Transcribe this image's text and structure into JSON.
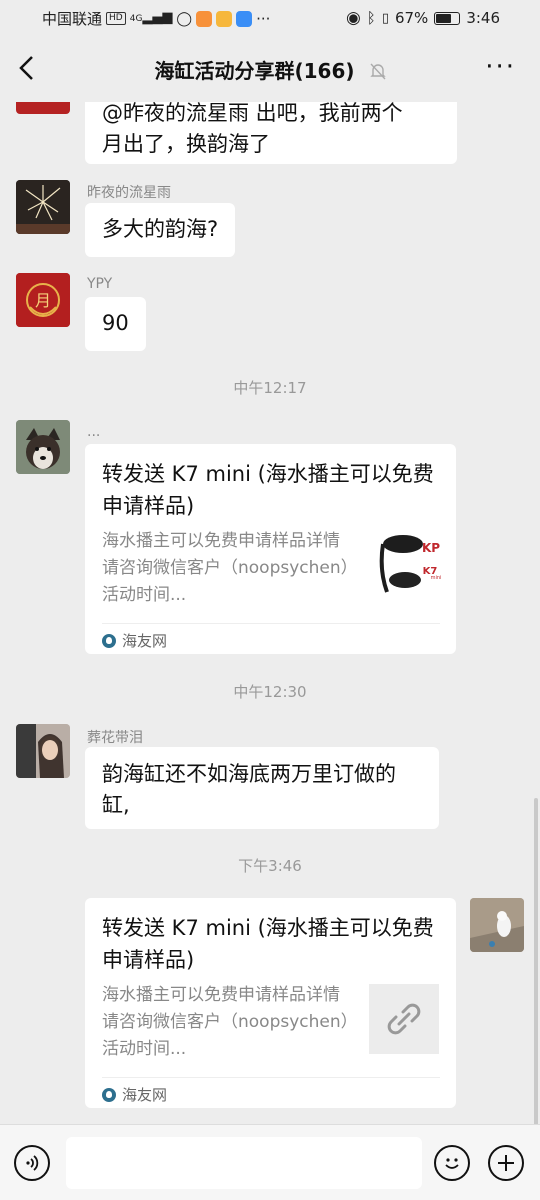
{
  "status_bar": {
    "carrier": "中国联通",
    "hd": "HD",
    "network": "4G",
    "more": "···",
    "battery": "67%",
    "battery_level": 0.67,
    "time": "3:46"
  },
  "nav": {
    "title": "海缸活动分享群(166)",
    "back_icon": "back-chevron-icon",
    "mute_icon": "bell-muted-icon",
    "more_icon": "more-icon"
  },
  "messages": [
    {
      "type": "text",
      "sender": "",
      "text_line1": "@昨夜的流星雨  出吧，我前两个",
      "text_line2": "月出了，换韵海了"
    },
    {
      "type": "text",
      "sender": "昨夜的流星雨",
      "text": "多大的韵海?"
    },
    {
      "type": "text",
      "sender": "YPY",
      "text": "90"
    },
    {
      "type": "time",
      "text": "中午12:17"
    },
    {
      "type": "card",
      "sender": "...",
      "title": "转发送 K7 mini (海水播主可以免费申请样品)",
      "desc": "海水播主可以免费申请样品详情请咨询微信客户（noopsychen）活动时间...",
      "source": "海友网"
    },
    {
      "type": "time",
      "text": "中午12:30"
    },
    {
      "type": "text",
      "sender": "葬花带泪",
      "text": "韵海缸还不如海底两万里订做的缸,"
    },
    {
      "type": "time",
      "text": "下午3:46"
    },
    {
      "type": "card-self",
      "title": "转发送 K7 mini (海水播主可以免费申请样品)",
      "desc": "海水播主可以免费申请样品详情请咨询微信客户（noopsychen）活动时间...",
      "source": "海友网",
      "thumb_icon": "link-icon"
    }
  ],
  "thumb_labels": {
    "brand": "KP",
    "model": "K7",
    "model_sub": "mini"
  },
  "input_bar": {
    "voice_icon": "voice-icon",
    "emoji_icon": "emoji-icon",
    "plus_icon": "plus-icon",
    "placeholder": ""
  },
  "colors": {
    "background": "#ededed",
    "bubble": "#ffffff",
    "muted_text": "#888888"
  }
}
